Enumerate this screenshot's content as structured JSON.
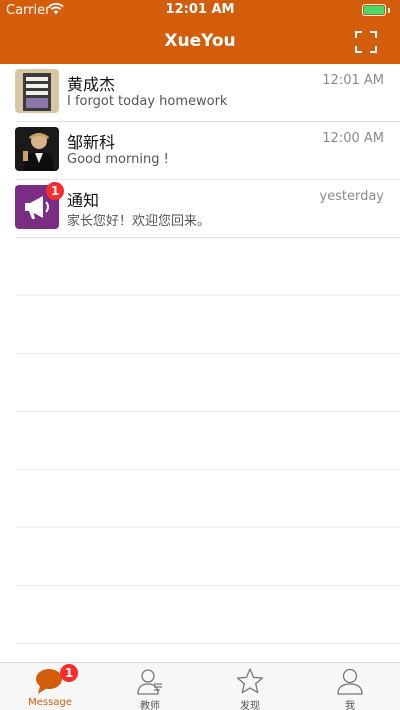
{
  "status_bar": {
    "carrier": "Carrier",
    "time": "12:01 AM"
  },
  "nav": {
    "title": "XueYou"
  },
  "messages": [
    {
      "name": "黄成杰",
      "preview": "I forgot today homework",
      "time": "12:01 AM"
    },
    {
      "name": "邹新科",
      "preview": "Good morning !",
      "time": "12:00 AM"
    },
    {
      "name": "通知",
      "preview": "家长您好！欢迎您回来。",
      "time": "yesterday",
      "badge": "1"
    }
  ],
  "tabs": [
    {
      "label": "Message",
      "badge": "1",
      "icon": "chat-bubble-icon"
    },
    {
      "label": "教师",
      "icon": "teacher-icon"
    },
    {
      "label": "发现",
      "icon": "star-icon"
    },
    {
      "label": "我",
      "icon": "person-icon"
    }
  ],
  "colors": {
    "accent": "#d35d0b",
    "badge": "#fb2b2b",
    "battery": "#4cd964"
  }
}
